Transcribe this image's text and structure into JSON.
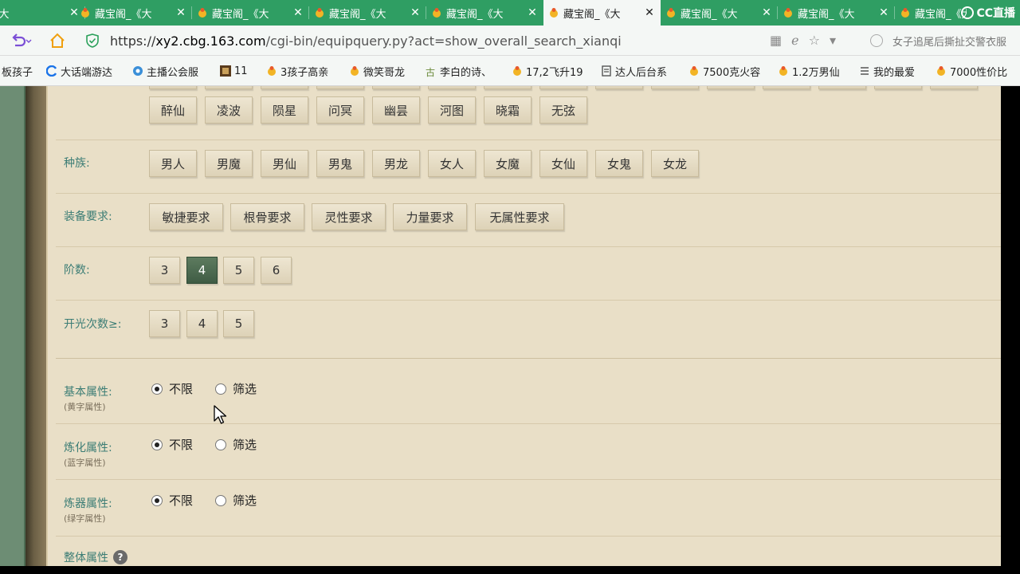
{
  "tabs": [
    {
      "title": "阁_《大"
    },
    {
      "title": "藏宝阁_《大"
    },
    {
      "title": "藏宝阁_《大"
    },
    {
      "title": "藏宝阁_《大"
    },
    {
      "title": "藏宝阁_《大"
    },
    {
      "title": "藏宝阁_《大"
    },
    {
      "title": "藏宝阁_《大"
    },
    {
      "title": "藏宝阁_《大"
    },
    {
      "title": "藏宝阁_《大"
    }
  ],
  "tab_close": "✕",
  "cc_logo": "CC直播",
  "address": {
    "protocol": "https://",
    "host": "xy2.cbg.163.com",
    "path": "/cgi-bin/equipquery.py?act=show_overall_search_xianqi",
    "search_text": "女子追尾后撕扯交警衣服"
  },
  "bookmarks": [
    {
      "label": "板孩子"
    },
    {
      "label": "大话端游达"
    },
    {
      "label": "主播公会服"
    },
    {
      "label": "11"
    },
    {
      "label": "3孩子高亲"
    },
    {
      "label": "微笑哥龙"
    },
    {
      "label": "李白的诗、"
    },
    {
      "label": "17,2飞升19"
    },
    {
      "label": "达人后台系"
    },
    {
      "label": "7500克火容"
    },
    {
      "label": "1.2万男仙"
    },
    {
      "label": "我的最爱"
    },
    {
      "label": "7000性价比"
    }
  ],
  "form": {
    "name_row": {
      "options": [
        "醉仙",
        "凌波",
        "陨星",
        "问冥",
        "幽昙",
        "河图",
        "晓霜",
        "无弦"
      ]
    },
    "race": {
      "label": "种族:",
      "options": [
        "男人",
        "男魔",
        "男仙",
        "男鬼",
        "男龙",
        "女人",
        "女魔",
        "女仙",
        "女鬼",
        "女龙"
      ]
    },
    "equip_req": {
      "label": "装备要求:",
      "options": [
        "敏捷要求",
        "根骨要求",
        "灵性要求",
        "力量要求",
        "无属性要求"
      ]
    },
    "tier": {
      "label": "阶数:",
      "options": [
        "3",
        "4",
        "5",
        "6"
      ],
      "selected": "4"
    },
    "open_count": {
      "label": "开光次数≥:",
      "options": [
        "3",
        "4",
        "5"
      ]
    },
    "basic_attr": {
      "label": "基本属性:",
      "sub": "(黄字属性)",
      "opt_any": "不限",
      "opt_filter": "筛选",
      "selected": "不限"
    },
    "refine_attr": {
      "label": "炼化属性:",
      "sub": "(蓝字属性)",
      "opt_any": "不限",
      "opt_filter": "筛选",
      "selected": "不限"
    },
    "forge_attr": {
      "label": "炼器属性:",
      "sub": "(绿字属性)",
      "opt_any": "不限",
      "opt_filter": "筛选",
      "selected": "不限"
    },
    "overall_attr": {
      "label": "整体属性",
      "help": "?"
    }
  },
  "colors": {
    "tab_green": "#2f9e63",
    "page_bg": "#e9dfc7",
    "label_teal": "#3c7d75",
    "selected_btn": "#4a684f"
  }
}
